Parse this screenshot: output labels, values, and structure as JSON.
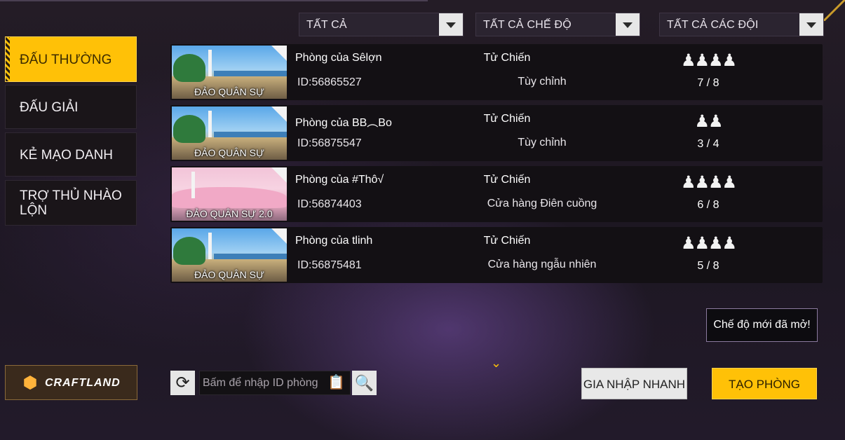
{
  "filters": [
    {
      "label": "TẤT CẢ"
    },
    {
      "label": "TẤT CẢ CHẾ ĐỘ"
    },
    {
      "label": "TẤT CẢ CÁC ĐỘI"
    }
  ],
  "menu": {
    "items": [
      {
        "label": "ĐẤU THƯỜNG",
        "active": true
      },
      {
        "label": "ĐẤU GIẢI"
      },
      {
        "label": "KẺ MẠO DANH"
      },
      {
        "label": "TRỢ THỦ NHÀO LỘN"
      }
    ]
  },
  "rooms": [
    {
      "map": "ĐẢO QUÂN SỰ",
      "name": "Phòng của Sêlợn",
      "id": "ID:56865527",
      "mode": "Tử Chiến",
      "sub": "Tùy chỉnh",
      "players": "♟♟♟♟",
      "count": "7 / 8"
    },
    {
      "map": "ĐẢO QUÂN SỰ",
      "name": "Phòng của BB︵Bo",
      "id": "ID:56875547",
      "mode": "Tử Chiến",
      "sub": "Tùy chỉnh",
      "players": "♟♟",
      "count": "3 / 4"
    },
    {
      "map": "ĐẢO QUÂN SỰ 2.0",
      "name": "Phòng của #Thô√",
      "id": "ID:56874403",
      "mode": "Tử Chiến",
      "sub": "Cửa hàng Điên cuồng",
      "players": "♟♟♟♟",
      "count": "6 / 8"
    },
    {
      "map": "ĐẢO QUÂN SỰ",
      "name": "Phòng của tlinh",
      "id": "ID:56875481",
      "mode": "Tử Chiến",
      "sub": "Cửa hàng ngẫu nhiên",
      "players": "♟♟♟♟",
      "count": "5 / 8"
    }
  ],
  "craftland": {
    "label": "CRAFTLAND",
    "icon": "craftland-logo-icon"
  },
  "search": {
    "placeholder": "Bấm để nhập ID phòng"
  },
  "notice": "Chế độ mới đã mở!",
  "buttons": {
    "quick_join": "GIA NHẬP NHANH",
    "create_room": "TẠO PHÒNG"
  },
  "colors": {
    "accent": "#ffc107",
    "background": "#1f1822"
  }
}
